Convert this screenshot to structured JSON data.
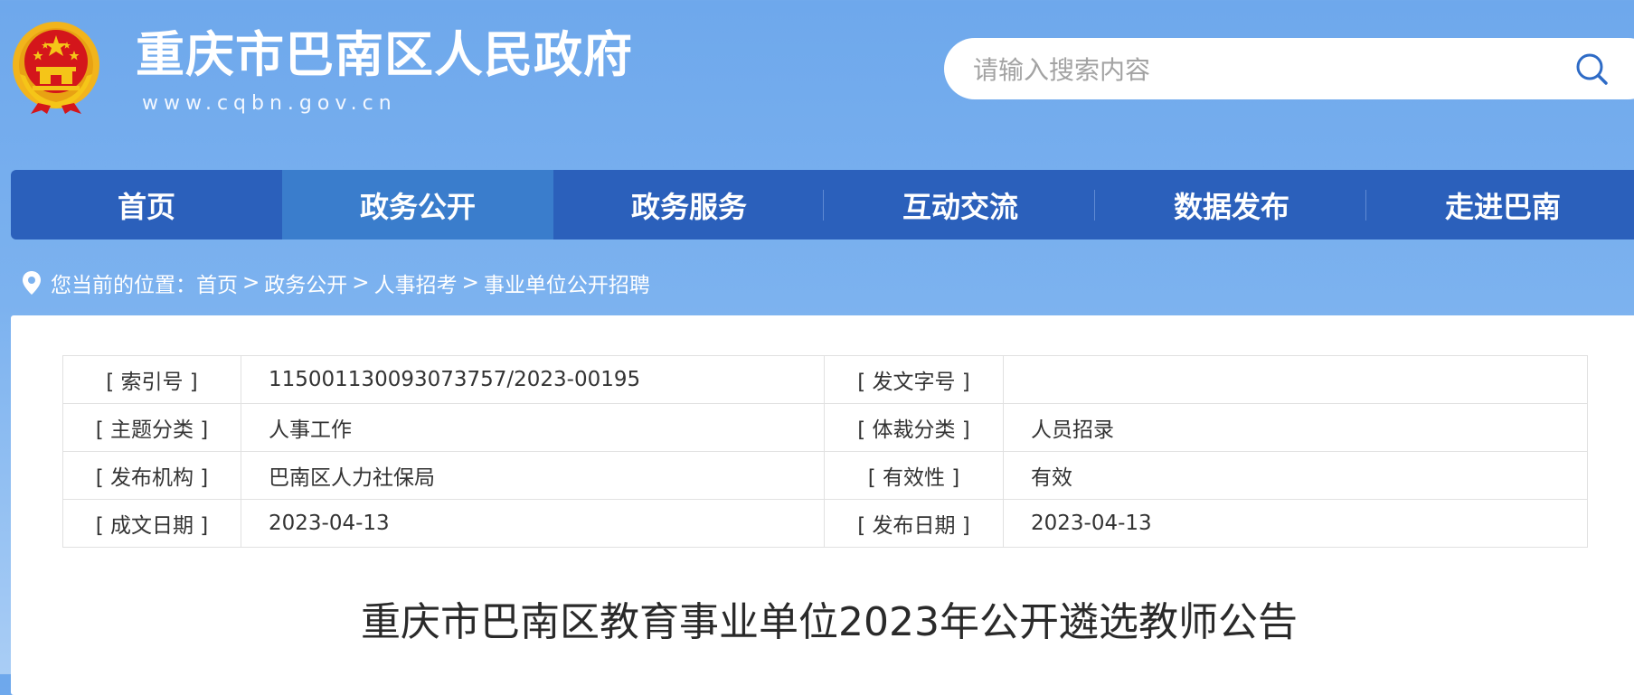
{
  "header": {
    "site_title": "重庆市巴南区人民政府",
    "site_url": "www.cqbn.gov.cn",
    "emblem_icon": "national-emblem-icon",
    "search": {
      "placeholder": "请输入搜索内容",
      "value": "",
      "icon": "search-icon"
    }
  },
  "nav": {
    "items": [
      {
        "label": "首页"
      },
      {
        "label": "政务公开",
        "active": true
      },
      {
        "label": "政务服务"
      },
      {
        "label": "互动交流"
      },
      {
        "label": "数据发布"
      },
      {
        "label": "走进巴南"
      }
    ]
  },
  "breadcrumb": {
    "prefix": "您当前的位置：",
    "items": [
      "首页",
      "政务公开",
      "人事招考",
      "事业单位公开招聘"
    ],
    "separator": " >",
    "icon": "location-pin-icon"
  },
  "meta": {
    "rows": [
      {
        "k1": "[ 索引号 ]",
        "v1": "115001130093073757/2023-00195",
        "k2": "[ 发文字号 ]",
        "v2": ""
      },
      {
        "k1": "[ 主题分类 ]",
        "v1": "人事工作",
        "k2": "[ 体裁分类 ]",
        "v2": "人员招录"
      },
      {
        "k1": "[ 发布机构 ]",
        "v1": "巴南区人力社保局",
        "k2": "[ 有效性 ]",
        "v2": "有效"
      },
      {
        "k1": "[ 成文日期 ]",
        "v1": "2023-04-13",
        "k2": "[ 发布日期 ]",
        "v2": "2023-04-13"
      }
    ]
  },
  "article": {
    "title": "重庆市巴南区教育事业单位2023年公开遴选教师公告"
  },
  "colors": {
    "nav_bg": "#2b60bb",
    "nav_active": "#3a7dcc",
    "header_bg": "#6ea8ec",
    "emblem_red": "#d4161b",
    "emblem_gold": "#f5c518"
  }
}
